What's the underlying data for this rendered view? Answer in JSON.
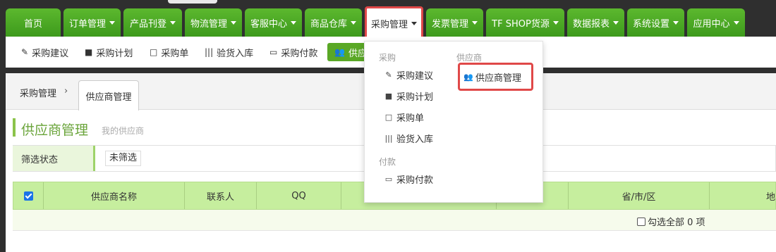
{
  "nav": {
    "tabs": [
      {
        "label": "首页",
        "caret": false
      },
      {
        "label": "订单管理",
        "caret": true
      },
      {
        "label": "产品刊登",
        "caret": true
      },
      {
        "label": "物流管理",
        "caret": true
      },
      {
        "label": "客服中心",
        "caret": true
      },
      {
        "label": "商品仓库",
        "caret": true
      },
      {
        "label": "采购管理",
        "caret": true,
        "active": true
      },
      {
        "label": "发票管理",
        "caret": true
      },
      {
        "label": "TF SHOP货源",
        "caret": true
      },
      {
        "label": "数据报表",
        "caret": true
      },
      {
        "label": "系统设置",
        "caret": true
      },
      {
        "label": "应用中心",
        "caret": true
      }
    ]
  },
  "toolbar": {
    "items": [
      {
        "label": "采购建议",
        "icon": "wand-icon"
      },
      {
        "label": "采购计划",
        "icon": "book-icon"
      },
      {
        "label": "采购单",
        "icon": "file-icon"
      },
      {
        "label": "验货入库",
        "icon": "barcode-icon"
      },
      {
        "label": "采购付款",
        "icon": "credit-card-icon"
      },
      {
        "label": "供应",
        "icon": "users-icon"
      }
    ]
  },
  "breadcrumb": {
    "root": "采购管理",
    "separator": "›",
    "current": "供应商管理"
  },
  "page": {
    "title": "供应商管理",
    "subtitle": "我的供应商"
  },
  "filter": {
    "label": "筛选状态",
    "value": "未筛选"
  },
  "table": {
    "headers": [
      "供应商名称",
      "联系人",
      "QQ",
      "",
      "",
      "省/市/区",
      "地"
    ]
  },
  "footer": {
    "select_all": "勾选全部 0 项"
  },
  "dropdown": {
    "purchase_header": "采购",
    "purchase_items": [
      {
        "label": "采购建议",
        "icon": "wand-icon"
      },
      {
        "label": "采购计划",
        "icon": "book-icon"
      },
      {
        "label": "采购单",
        "icon": "file-icon"
      },
      {
        "label": "验货入库",
        "icon": "barcode-icon"
      }
    ],
    "payment_header": "付款",
    "payment_items": [
      {
        "label": "采购付款",
        "icon": "credit-card-icon"
      }
    ],
    "supplier_header": "供应商",
    "supplier_items": [
      {
        "label": "供应商管理",
        "icon": "users-icon"
      }
    ]
  },
  "colors": {
    "nav_green": "#4caf24",
    "highlight_red": "#e04848",
    "title_green": "#6aa43a",
    "header_green": "#c6ee9e"
  }
}
